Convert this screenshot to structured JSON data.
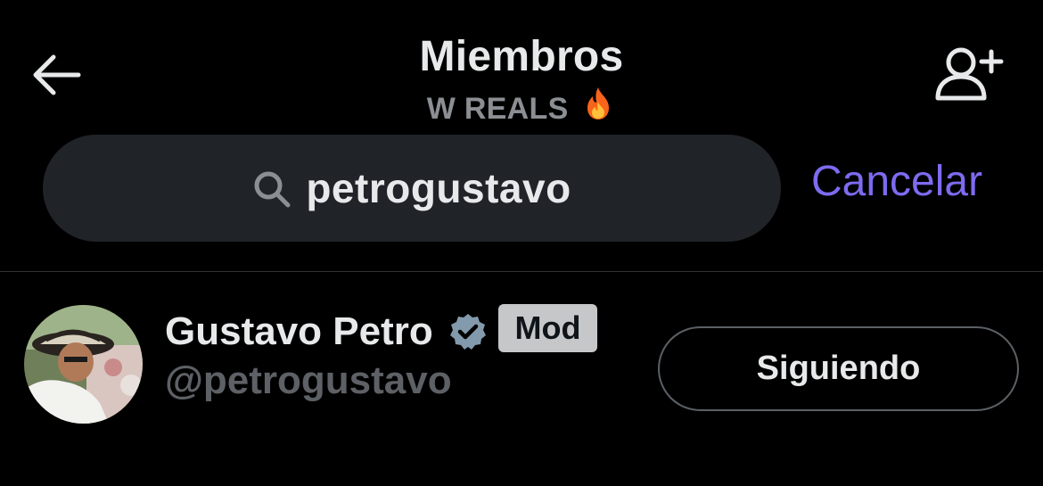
{
  "header": {
    "title": "Miembros",
    "subtitle": "W REALS",
    "subtitle_emoji_icon": "fire-icon",
    "back_icon": "arrow-left-icon",
    "add_member_icon": "person-plus-icon"
  },
  "search": {
    "query": "petrogustavo",
    "icon": "search-icon",
    "cancel_label": "Cancelar"
  },
  "members": [
    {
      "name": "Gustavo Petro",
      "handle": "@petrogustavo",
      "verified": true,
      "badge": "Mod",
      "follow_label": "Siguiendo"
    }
  ],
  "colors": {
    "background": "#000000",
    "accent": "#7d6bf0",
    "verified": "#829aab",
    "search_bg": "#202327",
    "badge_bg": "#c6c7c9"
  }
}
